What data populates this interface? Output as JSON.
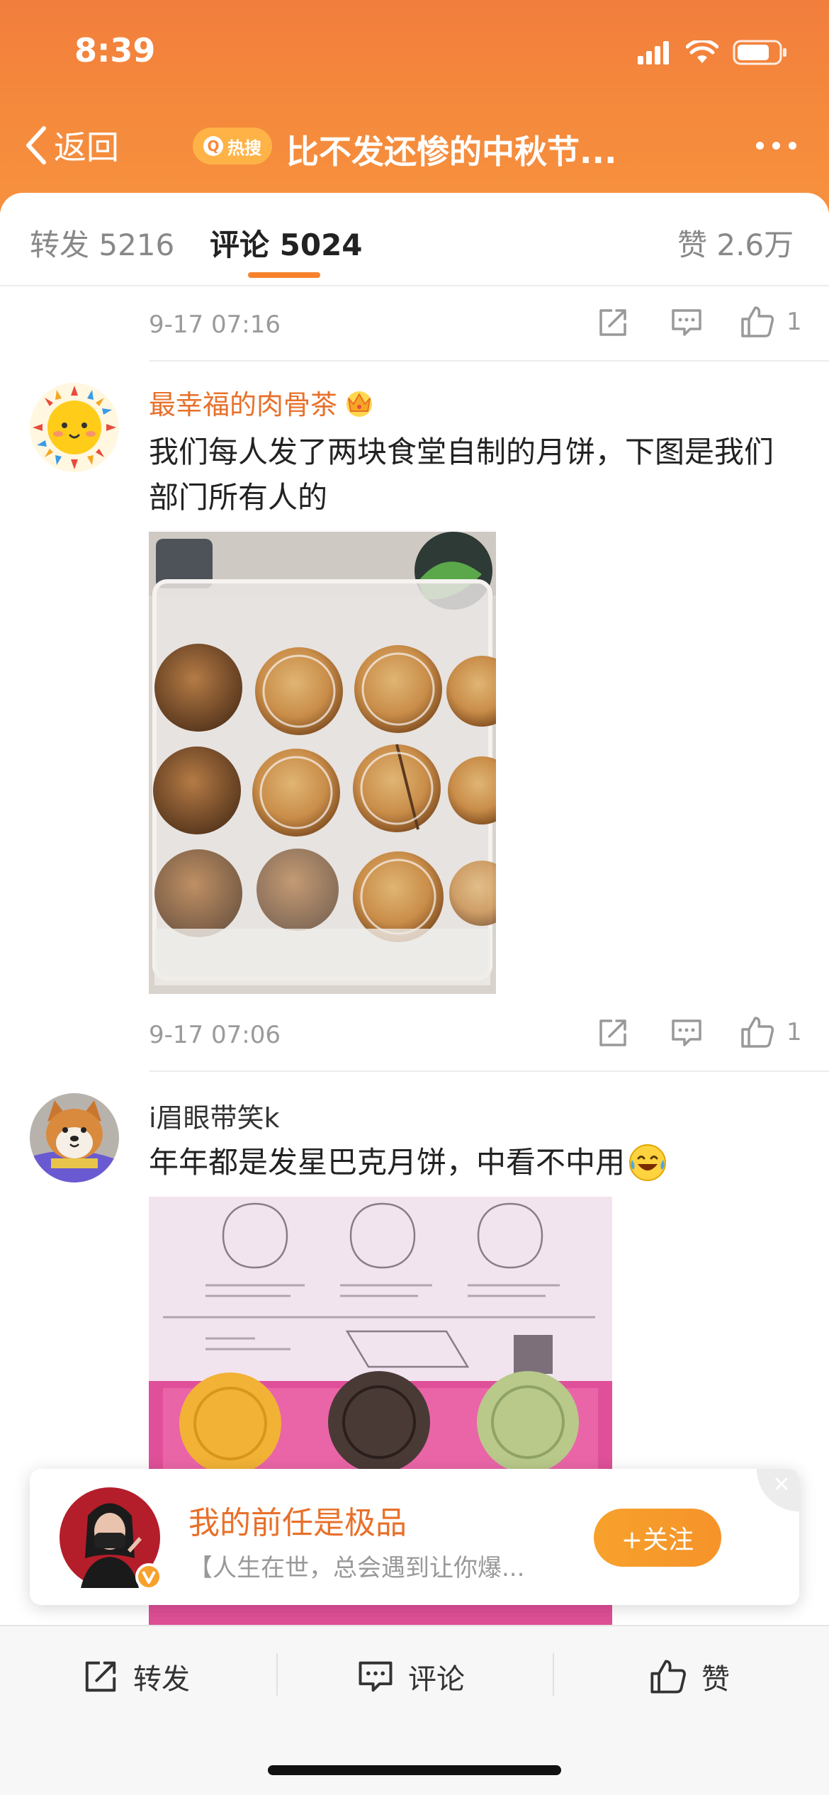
{
  "status": {
    "time": "8:39"
  },
  "header": {
    "back_label": "返回",
    "hot_badge": "热搜",
    "title": "比不发还惨的中秋节...",
    "bg_color": "#f58a3c"
  },
  "tabs": [
    {
      "label": "转发 5216",
      "active": false
    },
    {
      "label": "评论 5024",
      "active": true
    },
    {
      "label": "赞 2.6万",
      "active": false
    }
  ],
  "comments": [
    {
      "time": "9-17 07:16",
      "like_count": "1"
    },
    {
      "username": "最幸福的肉骨茶",
      "username_color": "#e8702a",
      "badge_icon": "crown-icon",
      "text": "我们每人发了两块食堂自制的月饼，下图是我们部门所有人的",
      "image": "mooncakes-in-plastic-tray-photo",
      "time": "9-17 07:06",
      "like_count": "1"
    },
    {
      "username": "i眉眼带笑k",
      "text": "年年都是发星巴克月饼，中看不中用",
      "text_emoji": "laugh-cry-emoji",
      "image": "starbucks-mooncake-box-photo"
    }
  ],
  "follow_card": {
    "name": "我的前任是极品",
    "description": "【人生在世，总会遇到让你爆...",
    "follow_label": "+关注",
    "verified_icon": "verified-v-icon"
  },
  "bottom_bar": {
    "repost_label": "转发",
    "comment_label": "评论",
    "like_label": "赞"
  }
}
